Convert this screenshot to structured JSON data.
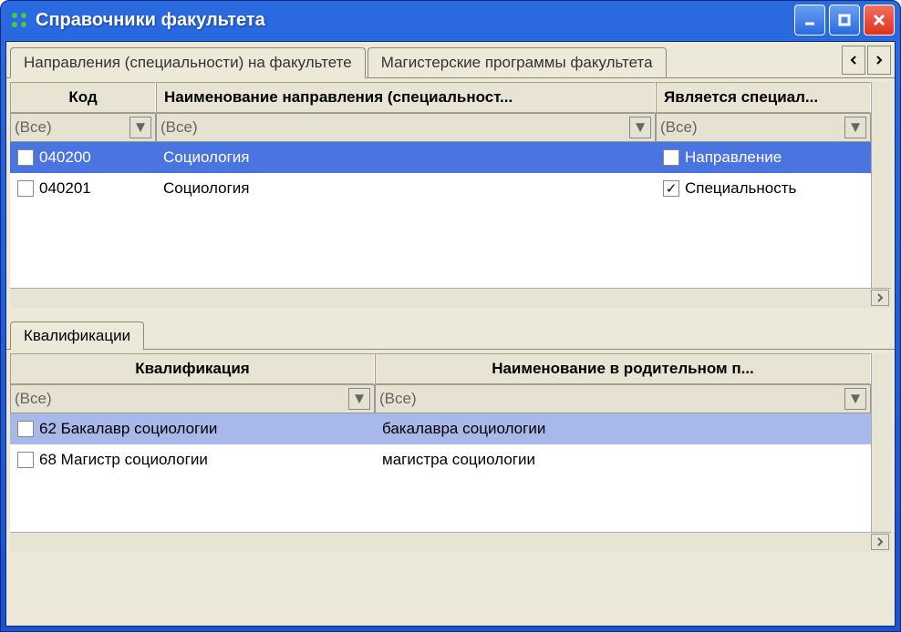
{
  "window": {
    "title": "Справочники факультета"
  },
  "tabs": {
    "active": "Направления (специальности) на факультете",
    "inactive": "Магистерские программы факультета"
  },
  "top_grid": {
    "headers": {
      "code": "Код",
      "name": "Наименование направления (специальност...",
      "is_spec": "Является специал..."
    },
    "filter_all": "(Все)",
    "rows": [
      {
        "code": "040200",
        "name": "Социология",
        "spec_label": "Направление",
        "checked": false
      },
      {
        "code": "040201",
        "name": "Социология",
        "spec_label": "Специальность",
        "checked": true
      }
    ]
  },
  "sub_tab": "Квалификации",
  "bottom_grid": {
    "headers": {
      "qual": "Квалификация",
      "genitive": "Наименование в родительном п..."
    },
    "filter_all": "(Все)",
    "rows": [
      {
        "qual": "62 Бакалавр социологии",
        "genitive": "бакалавра социологии"
      },
      {
        "qual": "68 Магистр социологии",
        "genitive": "магистра социологии"
      }
    ]
  }
}
